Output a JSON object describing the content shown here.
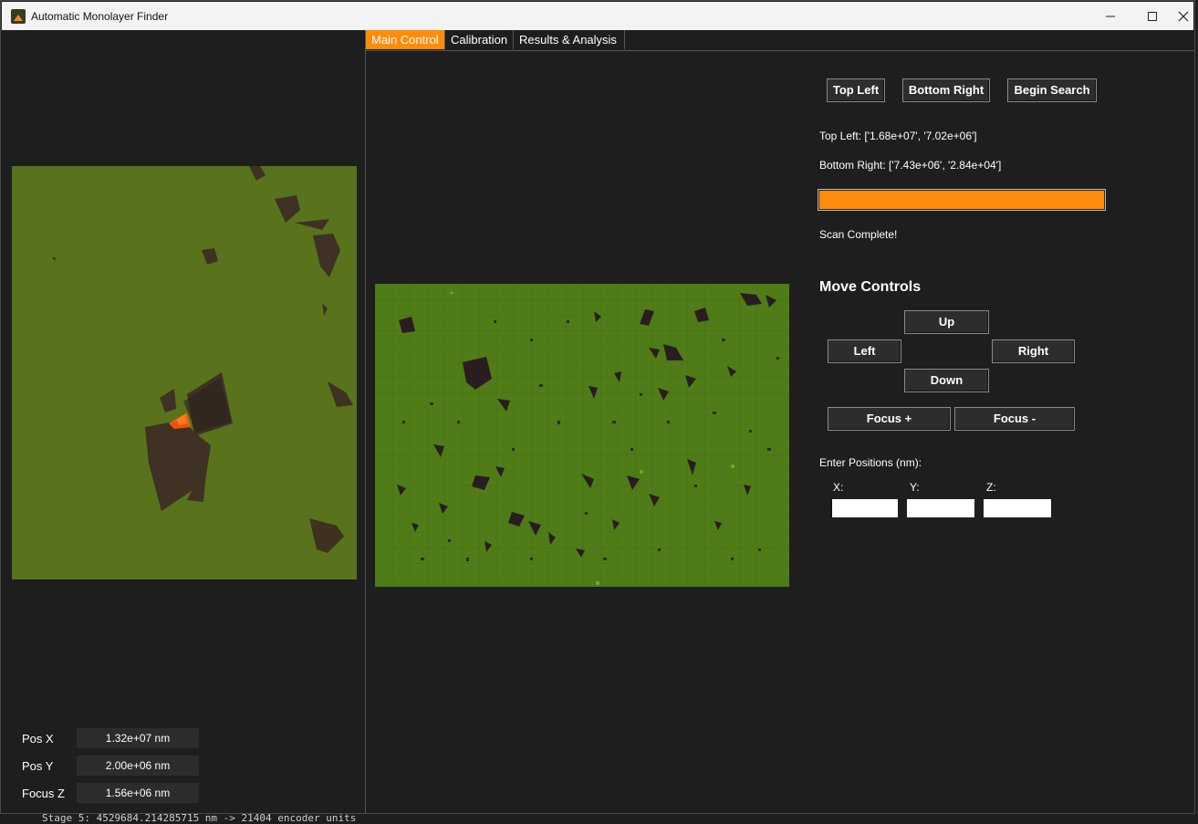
{
  "window": {
    "title": "Automatic Monolayer Finder"
  },
  "tabs": [
    {
      "label": "Main Control",
      "active": true
    },
    {
      "label": "Calibration",
      "active": false
    },
    {
      "label": "Results & Analysis",
      "active": false
    }
  ],
  "scan_controls": {
    "top_left_label": "Top Left",
    "bottom_right_label": "Bottom Right",
    "begin_search_label": "Begin Search",
    "top_left_text": "Top Left: ['1.68e+07', '7.02e+06']",
    "bottom_right_text": "Bottom Right: ['7.43e+06', '2.84e+04']",
    "progress": 1.0,
    "status": "Scan Complete!"
  },
  "move_controls": {
    "heading": "Move Controls",
    "up": "Up",
    "left": "Left",
    "right": "Right",
    "down": "Down",
    "focus_plus": "Focus +",
    "focus_minus": "Focus -"
  },
  "positions": {
    "heading": "Enter Positions (nm):",
    "x_label": "X:",
    "y_label": "Y:",
    "z_label": "Z:",
    "x_value": "",
    "y_value": "",
    "z_value": ""
  },
  "readouts": [
    {
      "label": "Pos X",
      "value": "1.32e+07 nm"
    },
    {
      "label": "Pos Y",
      "value": "2.00e+06 nm"
    },
    {
      "label": "Focus Z",
      "value": "1.56e+06 nm"
    }
  ],
  "console": {
    "line": "Stage 5: 4529684.214285715 nm -> 21404 encoder units"
  },
  "colors": {
    "accent": "#ff8c0a",
    "substrate": "#57731b",
    "flake": "#2a1d1d"
  }
}
